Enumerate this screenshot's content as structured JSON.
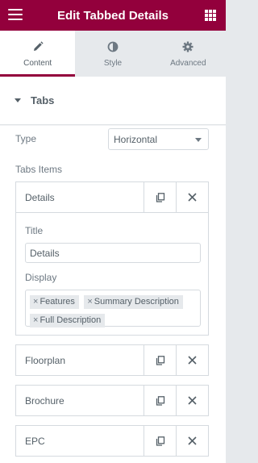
{
  "header": {
    "title": "Edit Tabbed Details",
    "menu_icon": "hamburger-icon",
    "apps_icon": "grid-icon",
    "bg_color": "#93003c"
  },
  "tabs": [
    {
      "label": "Content",
      "icon": "pencil-icon",
      "active": true
    },
    {
      "label": "Style",
      "icon": "half-circle-icon",
      "active": false
    },
    {
      "label": "Advanced",
      "icon": "gear-icon",
      "active": false
    }
  ],
  "section": {
    "title": "Tabs",
    "type_label": "Type",
    "type_value": "Horizontal",
    "items_label": "Tabs Items",
    "items": [
      {
        "name": "Details"
      },
      {
        "name": "Floorplan"
      },
      {
        "name": "Brochure"
      },
      {
        "name": "EPC"
      }
    ],
    "expanded": {
      "title_label": "Title",
      "title_value": "Details",
      "display_label": "Display",
      "display_values": [
        "Features",
        "Summary Description",
        "Full Description"
      ],
      "chip_remove": "×"
    }
  }
}
